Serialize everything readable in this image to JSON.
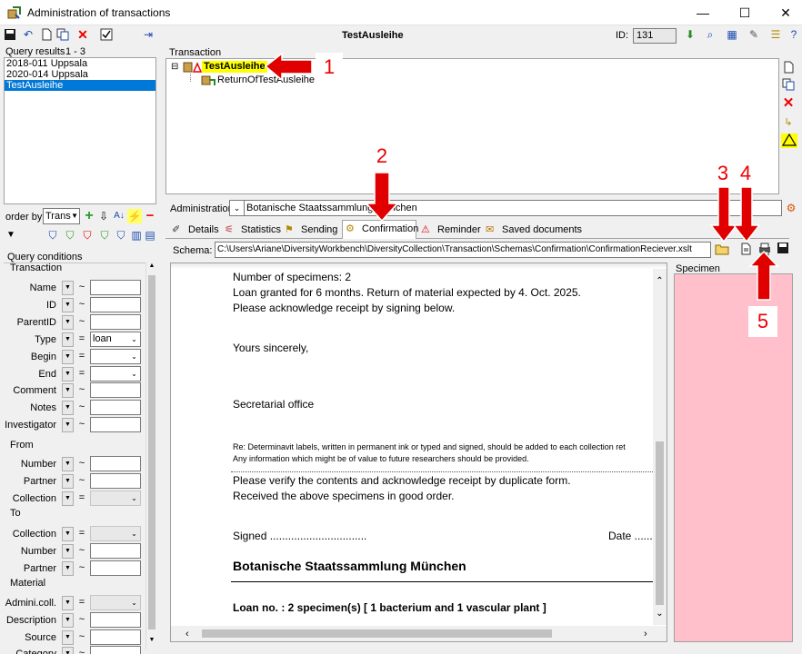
{
  "window": {
    "title": "Administration of transactions",
    "minimize_glyph": "—",
    "maximize_glyph": "☐",
    "close_glyph": "✕"
  },
  "toolbar": {
    "center_title": "TestAusleihe",
    "id_label": "ID:",
    "id_value": "131"
  },
  "query_results": {
    "label": "Query results",
    "count": "1 - 3",
    "items": [
      "2018-011 Uppsala",
      "2020-014 Uppsala",
      "TestAusleihe"
    ],
    "selected_index": 2
  },
  "order_by": {
    "label": "order by:",
    "value": "Trans"
  },
  "query_conditions": {
    "label": "Query conditions",
    "sections": {
      "transaction": "Transaction",
      "from": "From",
      "to": "To",
      "material": "Material"
    },
    "fields": {
      "name": {
        "label": "Name",
        "op": "~",
        "value": ""
      },
      "id": {
        "label": "ID",
        "op": "~",
        "value": ""
      },
      "parentid": {
        "label": "ParentID",
        "op": "~",
        "value": ""
      },
      "type": {
        "label": "Type",
        "op": "=",
        "value": "loan"
      },
      "begin": {
        "label": "Begin",
        "op": "=",
        "value": ""
      },
      "end": {
        "label": "End",
        "op": "=",
        "value": ""
      },
      "comment": {
        "label": "Comment",
        "op": "~",
        "value": ""
      },
      "notes": {
        "label": "Notes",
        "op": "~",
        "value": ""
      },
      "investigator": {
        "label": "Investigator",
        "op": "~",
        "value": ""
      },
      "from_number": {
        "label": "Number",
        "op": "~",
        "value": ""
      },
      "from_partner": {
        "label": "Partner",
        "op": "~",
        "value": ""
      },
      "from_collection": {
        "label": "Collection",
        "op": "=",
        "value": ""
      },
      "to_collection": {
        "label": "Collection",
        "op": "=",
        "value": ""
      },
      "to_number": {
        "label": "Number",
        "op": "~",
        "value": ""
      },
      "to_partner": {
        "label": "Partner",
        "op": "~",
        "value": ""
      },
      "admin_coll": {
        "label": "Admini.coll.",
        "op": "=",
        "value": ""
      },
      "description": {
        "label": "Description",
        "op": "~",
        "value": ""
      },
      "source": {
        "label": "Source",
        "op": "~",
        "value": ""
      },
      "category": {
        "label": "Category",
        "op": "~",
        "value": ""
      }
    }
  },
  "transaction": {
    "label": "Transaction",
    "tree": {
      "root": "TestAusleihe",
      "expander": "⊟",
      "child": "ReturnOfTestAusleihe"
    }
  },
  "administration": {
    "label": "Administration:",
    "value": "Botanische Staatssammlung München"
  },
  "tabs": [
    {
      "label": "Details",
      "icon": "details-icon"
    },
    {
      "label": "Statistics",
      "icon": "statistics-icon"
    },
    {
      "label": "Sending",
      "icon": "sending-icon"
    },
    {
      "label": "Confirmation",
      "icon": "confirmation-icon"
    },
    {
      "label": "Reminder",
      "icon": "reminder-icon"
    },
    {
      "label": "Saved documents",
      "icon": "saved-documents-icon"
    }
  ],
  "active_tab": 3,
  "schema": {
    "label": "Schema:",
    "value": "C:\\Users\\Ariane\\DiversityWorkbench\\DiversityCollection\\Transaction\\Schemas\\Confirmation\\ConfirmationReciever.xslt"
  },
  "document": {
    "lines": [
      "Number of specimens: 2",
      "Loan granted for 6 months. Return of material expected by 4. Oct. 2025.",
      "Please acknowledge receipt by signing below.",
      "Yours sincerely,",
      "Secretarial office"
    ],
    "small_lines": [
      "Re: Determinavit labels, written in permanent ink or typed and signed, should be added to each collection ret",
      "Any information which might be of value to future researchers should be provided."
    ],
    "lines2": [
      "Please verify the contents and acknowledge receipt by duplicate form.",
      "Received the above specimens in good order."
    ],
    "signed": "Signed ................................",
    "date": "Date ......",
    "institution": "Botanische Staatssammlung München",
    "loan_no": "Loan no. : 2 specimen(s) [ 1 bacterium and 1 vascular plant ]"
  },
  "specimen": {
    "label": "Specimen"
  },
  "annotations": [
    "1",
    "2",
    "3",
    "4",
    "5"
  ],
  "colors": {
    "selection": "#0078d7",
    "highlight": "#ffff00",
    "specimen_bg": "#ffc0cb",
    "callout": "#e00000"
  }
}
